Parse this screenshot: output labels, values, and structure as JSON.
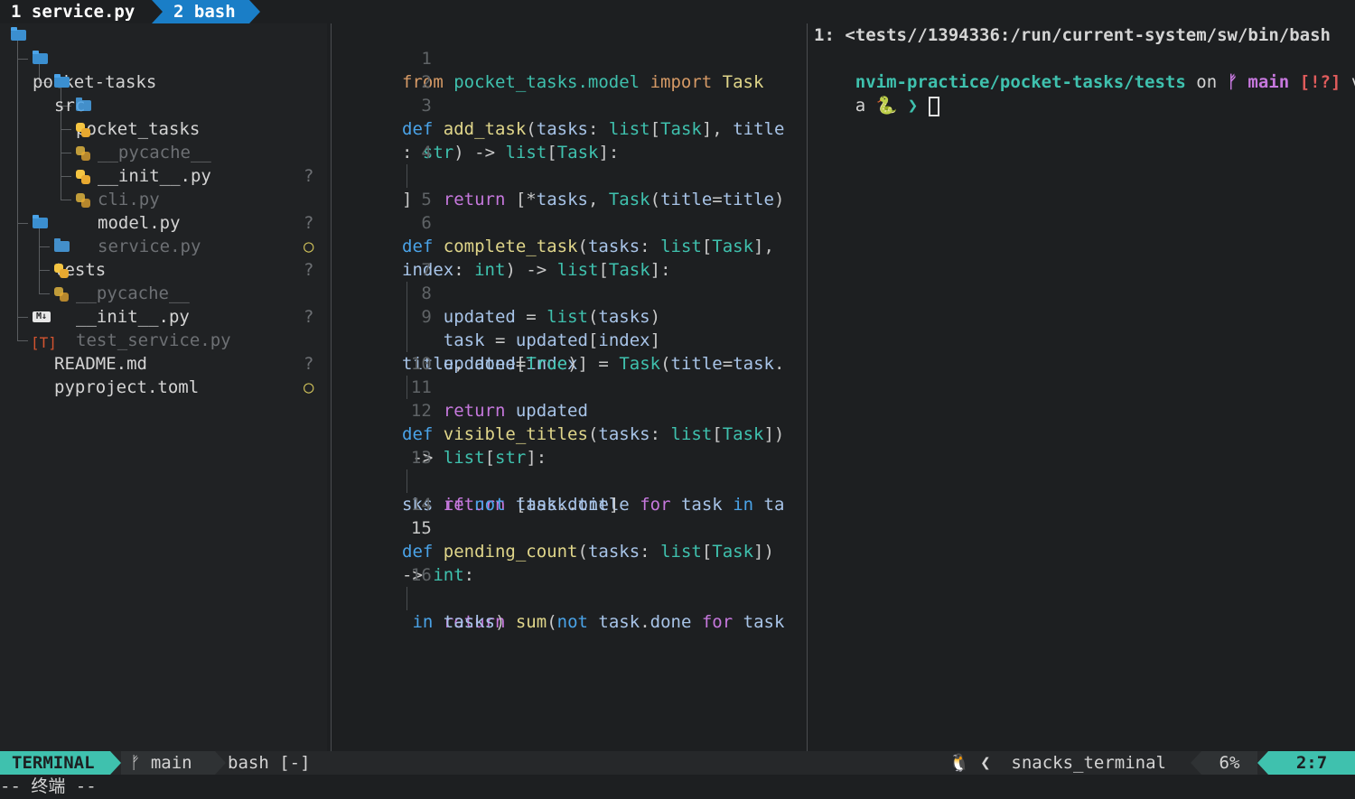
{
  "tabline": {
    "tab1": "1 service.py",
    "tab2": "2 bash"
  },
  "explorer": {
    "root": "pocket-tasks",
    "items": [
      {
        "label": "src"
      },
      {
        "label": "pocket_tasks"
      },
      {
        "label": "__pycache__",
        "status": "?"
      },
      {
        "label": "__init__.py"
      },
      {
        "label": "cli.py",
        "status": "?"
      },
      {
        "label": "model.py",
        "status": "○"
      },
      {
        "label": "service.py",
        "status": "?"
      },
      {
        "label": "tests"
      },
      {
        "label": "__pycache__",
        "status": "?"
      },
      {
        "label": "__init__.py"
      },
      {
        "label": "test_service.py",
        "status": "?"
      },
      {
        "label": "README.md",
        "status": "○"
      },
      {
        "label": "pyproject.toml"
      }
    ],
    "md_icon_text": "M↓",
    "toml_icon_text": "[T]"
  },
  "editor": {
    "line_numbers": [
      "1",
      "2",
      "3",
      "",
      "4",
      "",
      "5",
      "6",
      "",
      "7",
      "8",
      "9",
      "",
      "10",
      "11",
      "12",
      "",
      "13",
      "",
      "14",
      "15",
      "",
      "16",
      ""
    ]
  },
  "terminal": {
    "line1": "1: <tests//1394336:/run/current-system/sw/bin/bash",
    "path": "nvim-practice/pocket-tasks/tests",
    "on": " on ",
    "branch_icon": "ᚠ",
    "branch": " main",
    "flags": " [!?]",
    "via": " vi",
    "line3_prefix": "a ",
    "python_icon": "🐍",
    "prompt": " ❯ "
  },
  "statusline": {
    "mode": "TERMINAL",
    "branch": "ᚠ main",
    "file": "bash [-]",
    "filetype": "🐧 ❮  snacks_terminal",
    "percent": "6%",
    "position": "2:7"
  },
  "cmdline": {
    "text": "-- 终端 --"
  }
}
